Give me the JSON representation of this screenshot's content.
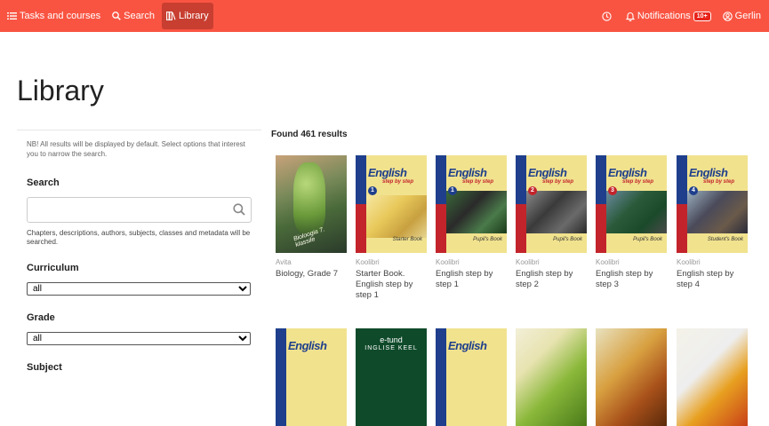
{
  "nav": {
    "tasks": "Tasks and courses",
    "search": "Search",
    "library": "Library",
    "notifications": "Notifications",
    "notif_count": "10+",
    "user": "Gerlin"
  },
  "page_title": "Library",
  "filters": {
    "note": "NB! All results will be displayed by default. Select options that interest you to narrow the search.",
    "search_label": "Search",
    "search_placeholder": "",
    "search_hint": "Chapters, descriptions, authors, subjects, classes and metadata will be searched.",
    "curriculum_label": "Curriculum",
    "curriculum_value": "all",
    "grade_label": "Grade",
    "grade_value": "all",
    "subject_label": "Subject"
  },
  "results": {
    "found": "Found 461 results",
    "books": [
      {
        "publisher": "Avita",
        "title": "Biology, Grade 7",
        "cover_text": "Bioloogia 7. klassile"
      },
      {
        "publisher": "Koolibri",
        "title": "Starter Book. English step by step 1",
        "cover_title": "English",
        "cover_sub": "step by step",
        "num": "1",
        "book_name": "Starter Book"
      },
      {
        "publisher": "Koolibri",
        "title": "English step by step 1",
        "cover_title": "English",
        "cover_sub": "step by step",
        "num": "1",
        "book_name": "Pupil's Book"
      },
      {
        "publisher": "Koolibri",
        "title": "English step by step 2",
        "cover_title": "English",
        "cover_sub": "step by step",
        "num": "2",
        "book_name": "Pupil's Book"
      },
      {
        "publisher": "Koolibri",
        "title": "English step by step 3",
        "cover_title": "English",
        "cover_sub": "step by step",
        "num": "3",
        "book_name": "Pupil's Book"
      },
      {
        "publisher": "Koolibri",
        "title": "English step by step 4",
        "cover_title": "English",
        "cover_sub": "step by step",
        "num": "4",
        "book_name": "Student's Book"
      }
    ],
    "row2": [
      {
        "cover_title": "English"
      },
      {
        "cover_title": "e-tund",
        "cover_sub": "INGLISE KEEL"
      },
      {
        "cover_title": "English"
      },
      {
        "cover_title": ""
      },
      {
        "cover_title": ""
      },
      {
        "cover_title": ""
      }
    ]
  },
  "colors": {
    "accent": "#f95442",
    "accent_dark": "#c83e30"
  }
}
